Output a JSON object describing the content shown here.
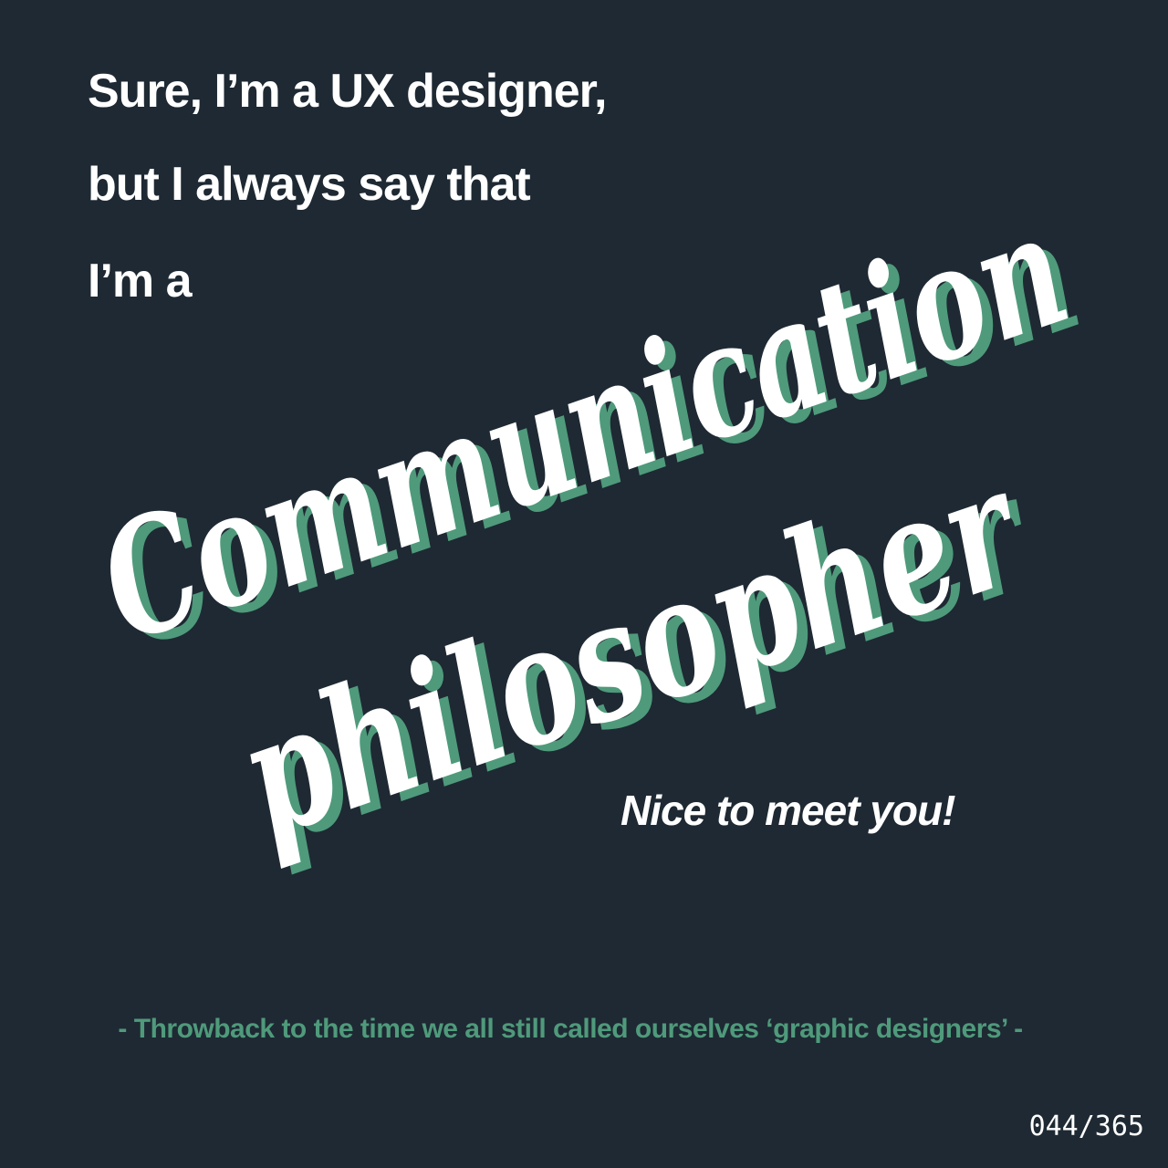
{
  "intro": {
    "line_1": "Sure, I’m a UX designer,",
    "line_2": "but I always say that",
    "line_3": "I’m a"
  },
  "headline": {
    "word_1": "Communication",
    "word_2": "philosopher"
  },
  "closing": "Nice to meet you!",
  "footnote": "- Throwback to the time we all still called ourselves ‘graphic designers’ -",
  "counter": "044/365",
  "colors": {
    "background": "#1e2933",
    "text": "#ffffff",
    "accent": "#4f9a7b"
  }
}
